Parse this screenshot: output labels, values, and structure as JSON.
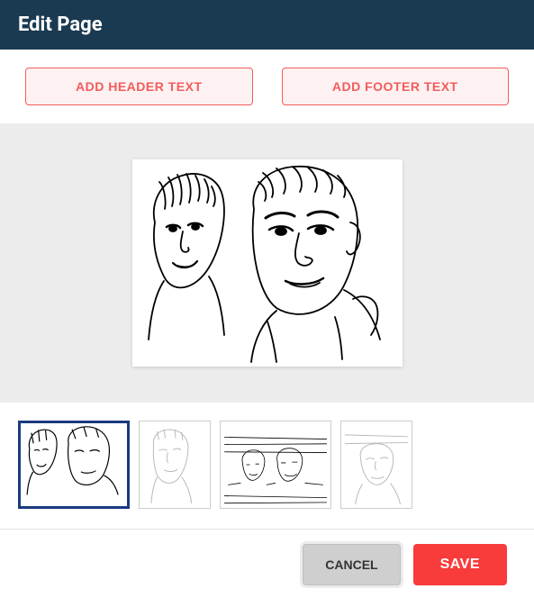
{
  "header": {
    "title": "Edit Page"
  },
  "toolbar": {
    "add_header_label": "ADD HEADER TEXT",
    "add_footer_label": "ADD FOOTER TEXT"
  },
  "thumbnails": {
    "selected_index": 0,
    "count": 4
  },
  "footer": {
    "cancel_label": "CANCEL",
    "save_label": "SAVE"
  },
  "colors": {
    "header_bg": "#1a3a52",
    "accent": "#f25c5c",
    "save": "#f83b3b",
    "selected_border": "#1a3a80"
  }
}
